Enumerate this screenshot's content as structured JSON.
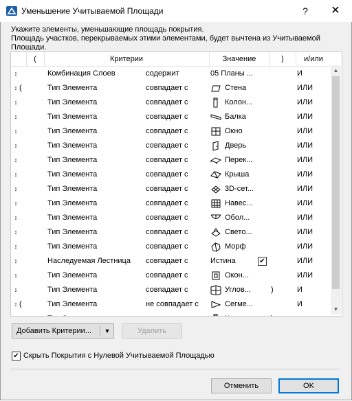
{
  "window": {
    "title": "Уменьшение Учитываемой Площади",
    "help": "?",
    "close": "✕"
  },
  "instructions": {
    "line1": "Укажите элементы, уменьшающие площадь покрытия.",
    "line2": "Площадь участков, перекрываемых этими элементами, будет вычтена из Учитываемой",
    "line3": "Площади."
  },
  "columns": {
    "lparen": "(",
    "criteria": "Критерии",
    "value": "Значение",
    "rparen": ")",
    "andor": "и/или"
  },
  "rows": [
    {
      "lparen": "",
      "criterion": "Комбинация Слоев",
      "op": "содержит",
      "icon": "",
      "value": "05 Планы ...",
      "rparen": "",
      "andor": "И"
    },
    {
      "lparen": "(",
      "criterion": "Тип Элемента",
      "op": "совпадает с",
      "icon": "wall-icon",
      "value": "Стена",
      "rparen": "",
      "andor": "ИЛИ"
    },
    {
      "lparen": "",
      "criterion": "Тип Элемента",
      "op": "совпадает с",
      "icon": "column-icon",
      "value": "Колон...",
      "rparen": "",
      "andor": "ИЛИ"
    },
    {
      "lparen": "",
      "criterion": "Тип Элемента",
      "op": "совпадает с",
      "icon": "beam-icon",
      "value": "Балка",
      "rparen": "",
      "andor": "ИЛИ"
    },
    {
      "lparen": "",
      "criterion": "Тип Элемента",
      "op": "совпадает с",
      "icon": "window-icon",
      "value": "Окно",
      "rparen": "",
      "andor": "ИЛИ"
    },
    {
      "lparen": "",
      "criterion": "Тип Элемента",
      "op": "совпадает с",
      "icon": "door-icon",
      "value": "Дверь",
      "rparen": "",
      "andor": "ИЛИ"
    },
    {
      "lparen": "",
      "criterion": "Тип Элемента",
      "op": "совпадает с",
      "icon": "slab-icon",
      "value": "Перек...",
      "rparen": "",
      "andor": "ИЛИ"
    },
    {
      "lparen": "",
      "criterion": "Тип Элемента",
      "op": "совпадает с",
      "icon": "roof-icon",
      "value": "Крыша",
      "rparen": "",
      "andor": "ИЛИ"
    },
    {
      "lparen": "",
      "criterion": "Тип Элемента",
      "op": "совпадает с",
      "icon": "mesh-icon",
      "value": "3D-сет...",
      "rparen": "",
      "andor": "ИЛИ"
    },
    {
      "lparen": "",
      "criterion": "Тип Элемента",
      "op": "совпадает с",
      "icon": "curtain-wall-icon",
      "value": "Навес...",
      "rparen": "",
      "andor": "ИЛИ"
    },
    {
      "lparen": "",
      "criterion": "Тип Элемента",
      "op": "совпадает с",
      "icon": "shell-icon",
      "value": "Обол...",
      "rparen": "",
      "andor": "ИЛИ"
    },
    {
      "lparen": "",
      "criterion": "Тип Элемента",
      "op": "совпадает с",
      "icon": "skylight-icon",
      "value": "Свето...",
      "rparen": "",
      "andor": "ИЛИ"
    },
    {
      "lparen": "",
      "criterion": "Тип Элемента",
      "op": "совпадает с",
      "icon": "morph-icon",
      "value": "Морф",
      "rparen": "",
      "andor": "ИЛИ"
    },
    {
      "lparen": "",
      "criterion": "Наследуемая Лестница",
      "op": "совпадает с",
      "icon": "",
      "value": "Истина",
      "checked": true,
      "rparen": "",
      "andor": "ИЛИ"
    },
    {
      "lparen": "",
      "criterion": "Тип Элемента",
      "op": "совпадает с",
      "icon": "opening-icon",
      "value": "Окон...",
      "rparen": "",
      "andor": "ИЛИ"
    },
    {
      "lparen": "",
      "criterion": "Тип Элемента",
      "op": "совпадает с",
      "icon": "corner-window-icon",
      "value": "Углов...",
      "rparen": ")",
      "andor": "И"
    },
    {
      "lparen": "(",
      "criterion": "Тип Элемента",
      "op": "не совпадает с",
      "icon": "segment-icon",
      "value": "Сегме...",
      "rparen": "",
      "andor": "И"
    },
    {
      "lparen": "",
      "criterion": "Тип Элемента",
      "op": "совпадает с",
      "icon": "column-icon",
      "value": "Колон...",
      "rparen": ")",
      "andor": ""
    }
  ],
  "buttons": {
    "add": "Добавить Критерии...",
    "delete": "Удалить",
    "cancel": "Отменить",
    "ok": "OK"
  },
  "options": {
    "hide_zero": "Скрыть Покрытия с Нулевой Учитываемой Площадью",
    "hide_zero_checked": true
  }
}
